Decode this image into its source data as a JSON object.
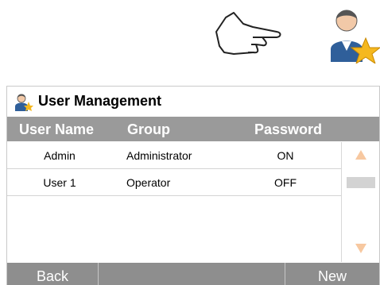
{
  "icons": {
    "top_hand": "pointing-hand-icon",
    "top_avatar": "user-star-icon",
    "title_icon": "user-management-icon"
  },
  "window": {
    "title": "User Management"
  },
  "table": {
    "headers": {
      "user_name": "User Name",
      "group": "Group",
      "password": "Password"
    },
    "rows": [
      {
        "user_name": "Admin",
        "group": "Administrator",
        "password": "ON"
      },
      {
        "user_name": "User 1",
        "group": "Operator",
        "password": "OFF"
      }
    ]
  },
  "footer": {
    "back_label": "Back",
    "new_label": "New"
  },
  "colors": {
    "header_bg": "#9a9a9a",
    "footer_bg": "#8e8e8e",
    "scroll_arrow": "#f7c8a0"
  }
}
